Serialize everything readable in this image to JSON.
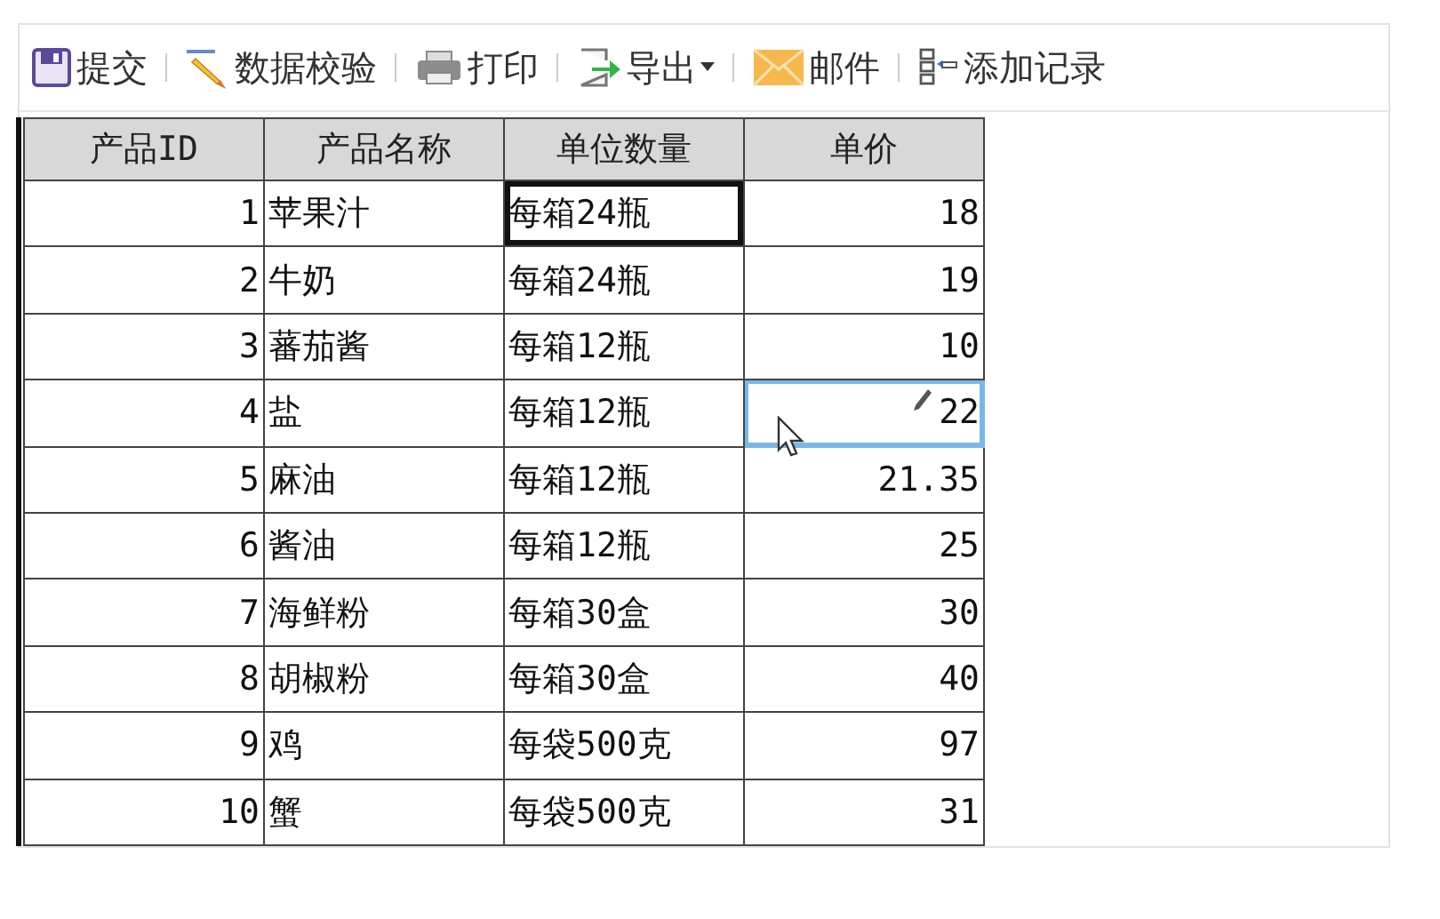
{
  "toolbar": [
    {
      "kind": "save",
      "label": "提交",
      "dropdown": false
    },
    {
      "kind": "validate",
      "label": "数据校验",
      "dropdown": false
    },
    {
      "kind": "print",
      "label": "打印",
      "dropdown": false
    },
    {
      "kind": "export",
      "label": "导出",
      "dropdown": true
    },
    {
      "kind": "mail",
      "label": "邮件",
      "dropdown": false
    },
    {
      "kind": "add",
      "label": "添加记录",
      "dropdown": false
    }
  ],
  "table": {
    "columns": [
      "产品ID",
      "产品名称",
      "单位数量",
      "单价"
    ],
    "rows": [
      {
        "id": "1",
        "name": "苹果汁",
        "unit": "每箱24瓶",
        "price": "18",
        "unit_selected": true,
        "price_editing": false
      },
      {
        "id": "2",
        "name": "牛奶",
        "unit": "每箱24瓶",
        "price": "19",
        "unit_selected": false,
        "price_editing": false
      },
      {
        "id": "3",
        "name": "蕃茄酱",
        "unit": "每箱12瓶",
        "price": "10",
        "unit_selected": false,
        "price_editing": false
      },
      {
        "id": "4",
        "name": "盐",
        "unit": "每箱12瓶",
        "price": "22",
        "unit_selected": false,
        "price_editing": true
      },
      {
        "id": "5",
        "name": "麻油",
        "unit": "每箱12瓶",
        "price": "21.35",
        "unit_selected": false,
        "price_editing": false
      },
      {
        "id": "6",
        "name": "酱油",
        "unit": "每箱12瓶",
        "price": "25",
        "unit_selected": false,
        "price_editing": false
      },
      {
        "id": "7",
        "name": "海鲜粉",
        "unit": "每箱30盒",
        "price": "30",
        "unit_selected": false,
        "price_editing": false
      },
      {
        "id": "8",
        "name": "胡椒粉",
        "unit": "每箱30盒",
        "price": "40",
        "unit_selected": false,
        "price_editing": false
      },
      {
        "id": "9",
        "name": "鸡",
        "unit": "每袋500克",
        "price": "97",
        "unit_selected": false,
        "price_editing": false
      },
      {
        "id": "10",
        "name": "蟹",
        "unit": "每袋500克",
        "price": "31",
        "unit_selected": false,
        "price_editing": false
      }
    ]
  }
}
